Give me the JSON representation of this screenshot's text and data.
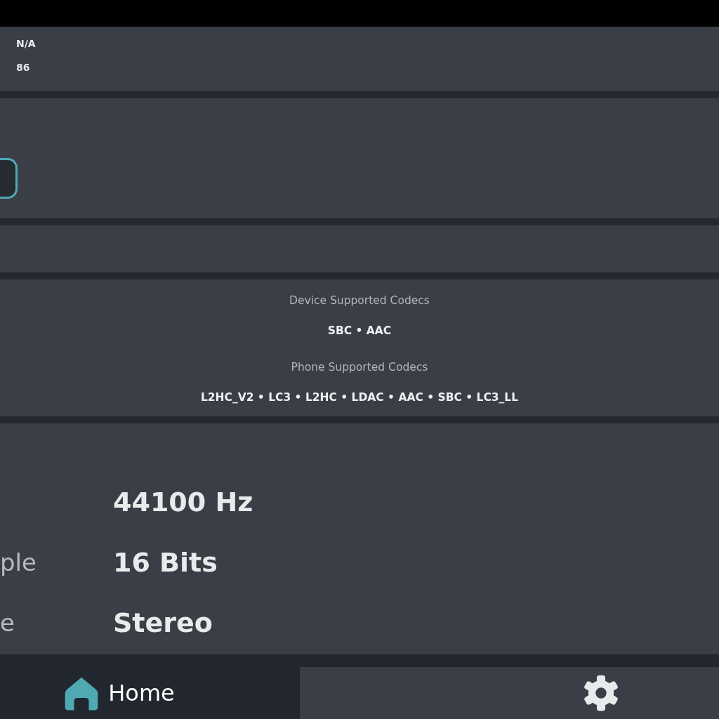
{
  "info_values": [
    "N/A",
    "86"
  ],
  "codecs": [
    {
      "heading": "Device Supported Codecs",
      "list": "SBC • AAC"
    },
    {
      "heading": "Phone Supported Codecs",
      "list": "L2HC_V2 • LC3 • L2HC • LDAC • AAC • SBC • LC3_LL"
    }
  ],
  "audio_rows": [
    {
      "value": "44100 Hz"
    },
    {
      "label": "ple",
      "value": "16 Bits"
    },
    {
      "label": "e",
      "value": "Stereo"
    }
  ],
  "nav_tabs": [
    {
      "kind": "home",
      "label": "Home",
      "selected": true
    },
    {
      "kind": "settings",
      "selected": false
    }
  ]
}
